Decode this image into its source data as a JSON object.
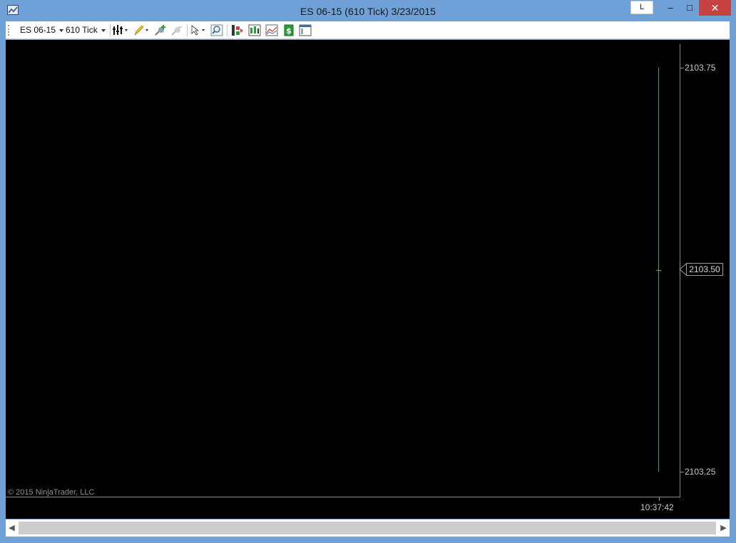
{
  "window": {
    "title": "ES 06-15 (610 Tick)  3/23/2015",
    "link_button": "L",
    "minimize": "–",
    "maximize": "□",
    "close": "✕"
  },
  "toolbar": {
    "instrument": "ES 06-15",
    "interval": "610 Tick",
    "icons": [
      "chart-style-icon",
      "drawing-tool-icon",
      "add-indicator-icon",
      "remove-indicator-icon",
      "select-cursor-icon",
      "zoom-icon",
      "strategies-icon",
      "bar-type-icon",
      "data-series-icon",
      "order-entry-icon",
      "properties-icon"
    ]
  },
  "chart": {
    "price_levels": [
      "2103.75",
      "2103.50",
      "2103.25"
    ],
    "current_price": "2103.50",
    "time_label": "10:37:42",
    "copyright": "© 2015 NinjaTrader, LLC",
    "bar_color": "#2fb34a"
  },
  "scrollbar": {
    "left_arrow": "◀",
    "right_arrow": "▶"
  }
}
